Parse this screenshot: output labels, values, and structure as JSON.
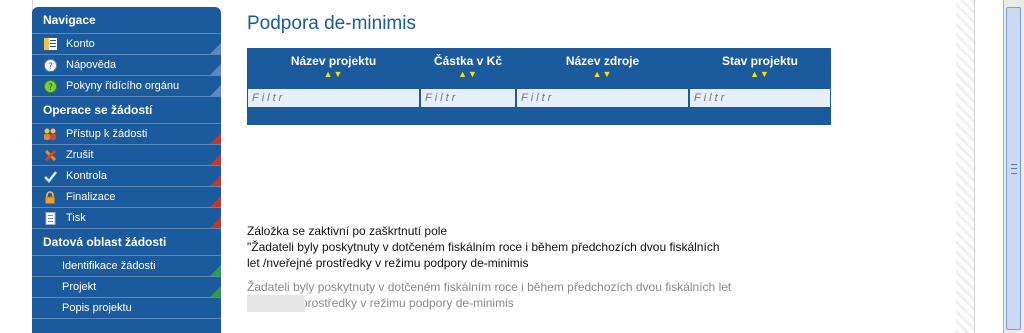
{
  "sidebar": {
    "sections": [
      {
        "title": "Navigace",
        "items": [
          {
            "label": "Konto",
            "icon": "ledger-icon"
          },
          {
            "label": "Nápověda",
            "icon": "help-icon"
          },
          {
            "label": "Pokyny řídícího orgánu",
            "icon": "guide-icon"
          }
        ]
      },
      {
        "title": "Operace se žádostí",
        "items": [
          {
            "label": "Přístup k žádosti",
            "icon": "users-icon"
          },
          {
            "label": "Zrušit",
            "icon": "cancel-icon"
          },
          {
            "label": "Kontrola",
            "icon": "check-icon"
          },
          {
            "label": "Finalizace",
            "icon": "lock-icon"
          },
          {
            "label": "Tisk",
            "icon": "print-icon"
          }
        ]
      },
      {
        "title": "Datová oblast žádosti",
        "items": [
          {
            "label": "Identifikace žádosti"
          },
          {
            "label": "Projekt"
          },
          {
            "label": "Popis projektu"
          }
        ]
      }
    ]
  },
  "main": {
    "title": "Podpora de-minimis",
    "grid": {
      "columns": [
        {
          "label": "Název projektu"
        },
        {
          "label": "Částka v Kč"
        },
        {
          "label": "Název zdroje"
        },
        {
          "label": "Stav projektu"
        }
      ],
      "sort_glyph": "▲▼",
      "filter_placeholder": "Filtr"
    },
    "notice": {
      "line1": "Záložka se zaktivní po zaškrtnutí pole",
      "line2": "\"Žadateli byly poskytnuty v dotčeném fiskálním roce i během předchozích dvou fiskálních",
      "line3": "let /nveřejné prostředky v režimu podpory de-minimis"
    },
    "checkbox_label": {
      "line1": "Žadateli byly poskytnuty v dotčeném fiskálním roce i během předchozích dvou fiskálních let",
      "line2": "prostředky v režimu podpory de-minimis"
    }
  },
  "colors": {
    "primary": "#1b5a9c",
    "sort_arrows": "#f3e600",
    "red_corner": "#c0392b",
    "green_corner": "#2e9b4a"
  }
}
